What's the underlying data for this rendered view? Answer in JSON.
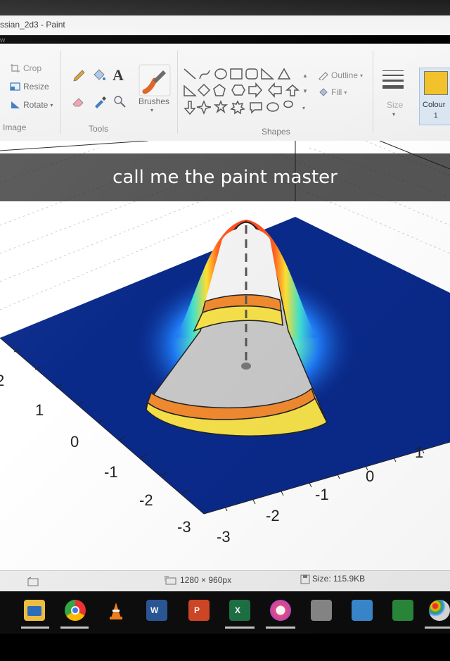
{
  "window": {
    "title": "ssian_2d3 - Paint",
    "menu_view": "w"
  },
  "ribbon": {
    "image_group": {
      "crop": "Crop",
      "resize": "Resize",
      "rotate": "Rotate",
      "label": "Image"
    },
    "tools_group": {
      "text_tool": "A",
      "label": "Tools"
    },
    "brushes": {
      "label": "Brushes"
    },
    "shapes_group": {
      "outline": "Outline",
      "fill": "Fill",
      "label": "Shapes"
    },
    "size": {
      "label": "Size"
    },
    "colour": {
      "label": "Colour",
      "index": "1",
      "swatch": "#f2c32b"
    }
  },
  "caption": {
    "text": "call me the paint master"
  },
  "plot": {
    "left_ticks": [
      "2",
      "1",
      "0",
      "-1",
      "-2",
      "-3"
    ],
    "right_ticks": [
      "-3",
      "-2",
      "-1",
      "0",
      "1"
    ],
    "colors": {
      "plane": "#0a2a8a",
      "cone": "#c8c8c8",
      "band_yellow": "#f5e04a",
      "band_orange": "#f08a30"
    }
  },
  "status": {
    "dimensions": "1280 × 960px",
    "size": "Size: 115.9KB"
  },
  "taskbar": {
    "icons": [
      "file-explorer-icon",
      "chrome-icon",
      "vlc-icon",
      "word-icon",
      "powerpoint-icon",
      "excel-icon",
      "itunes-icon",
      "scanner-icon",
      "monitor-icon",
      "camtasia-icon",
      "paint-icon"
    ],
    "word_letter": "W",
    "powerpoint_letter": "P",
    "excel_letter": "X"
  }
}
